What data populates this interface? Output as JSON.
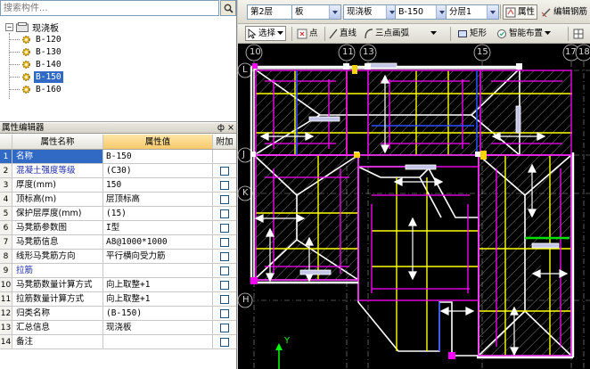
{
  "search": {
    "placeholder": "搜索构件..."
  },
  "tree": {
    "root_label": "现浇板",
    "items": [
      {
        "label": "B-120",
        "selected": false
      },
      {
        "label": "B-130",
        "selected": false
      },
      {
        "label": "B-140",
        "selected": false
      },
      {
        "label": "B-150",
        "selected": true
      },
      {
        "label": "B-160",
        "selected": false
      }
    ]
  },
  "prop_editor": {
    "title": "属性编辑器",
    "pin_glyph": "ф",
    "close_glyph": "×",
    "headers": {
      "name": "属性名称",
      "value": "属性值",
      "extra": "附加"
    },
    "rows": [
      {
        "no": "1",
        "name": "名称",
        "value": "B-150",
        "blue": true,
        "checkbox": false
      },
      {
        "no": "2",
        "name": "混凝土强度等级",
        "value": "(C30)",
        "blue": true,
        "checkbox": true
      },
      {
        "no": "3",
        "name": "厚度(mm)",
        "value": "150",
        "blue": false,
        "checkbox": true
      },
      {
        "no": "4",
        "name": "顶标高(m)",
        "value": "层顶标高",
        "blue": false,
        "checkbox": true
      },
      {
        "no": "5",
        "name": "保护层厚度(mm)",
        "value": "(15)",
        "blue": false,
        "checkbox": true
      },
      {
        "no": "6",
        "name": "马凳筋参数图",
        "value": "I型",
        "blue": false,
        "checkbox": true
      },
      {
        "no": "7",
        "name": "马凳筋信息",
        "value": "A8@1000*1000",
        "blue": false,
        "checkbox": true
      },
      {
        "no": "8",
        "name": "线形马凳筋方向",
        "value": "平行横向受力筋",
        "blue": false,
        "checkbox": true
      },
      {
        "no": "9",
        "name": "拉筋",
        "value": "",
        "blue": true,
        "checkbox": true
      },
      {
        "no": "10",
        "name": "马凳筋数量计算方式",
        "value": "向上取整+1",
        "blue": false,
        "checkbox": true
      },
      {
        "no": "11",
        "name": "拉筋数量计算方式",
        "value": "向上取整+1",
        "blue": false,
        "checkbox": true
      },
      {
        "no": "12",
        "name": "归类名称",
        "value": "(B-150)",
        "blue": false,
        "checkbox": true
      },
      {
        "no": "13",
        "name": "汇总信息",
        "value": "现浇板",
        "blue": false,
        "checkbox": true
      },
      {
        "no": "14",
        "name": "备注",
        "value": "",
        "blue": false,
        "checkbox": true
      }
    ]
  },
  "toolbar1": {
    "floor": "第2层",
    "category": "板",
    "type": "现浇板",
    "component": "B-150",
    "sublayer": "分层1",
    "properties_label": "属性",
    "edit_rebar_label": "编辑钢筋"
  },
  "toolbar2": {
    "select_label": "选择",
    "point_label": "点",
    "line_label": "直线",
    "arc_label": "三点画弧",
    "rect_label": "矩形",
    "smart_label": "智能布置"
  },
  "canvas": {
    "top_axes": [
      "10",
      "11",
      "13",
      "15",
      "17",
      "18"
    ],
    "left_axes": [
      "L",
      "J",
      "K",
      "H"
    ],
    "y_label": "Y",
    "colors": {
      "background": "#000000",
      "slab_border": "#ff00ff",
      "wall": "#ffffff",
      "beam": "#ffff00",
      "rebar": "#ffffff",
      "hatch": "#808080"
    }
  }
}
